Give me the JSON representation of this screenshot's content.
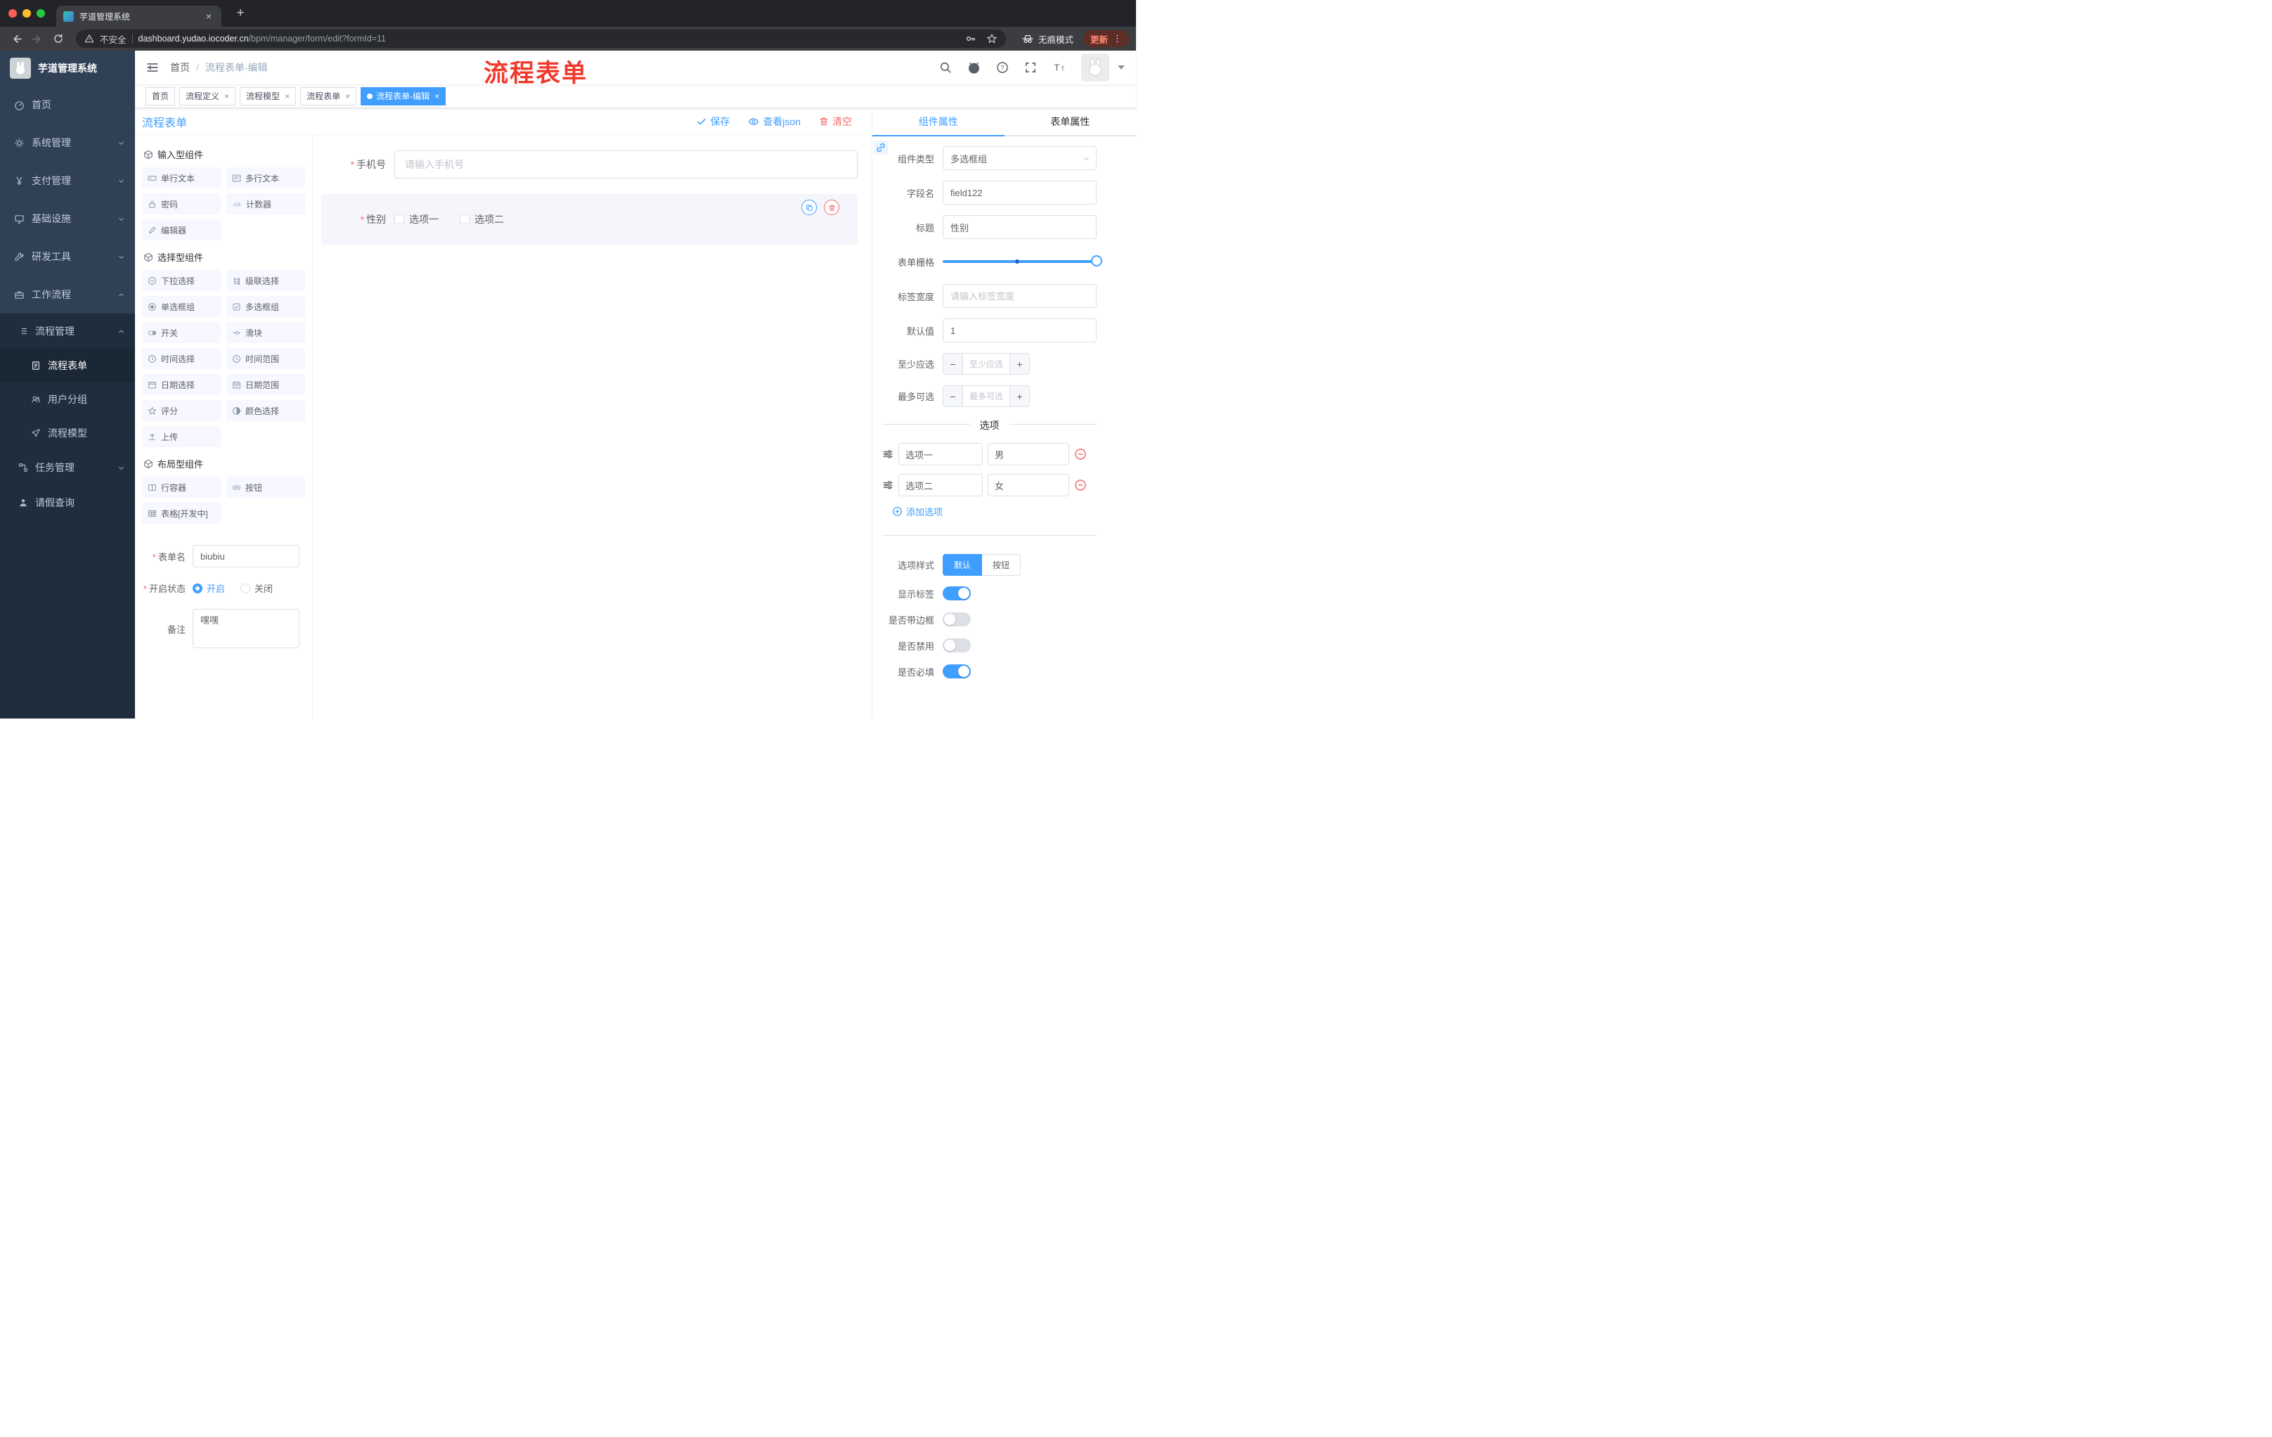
{
  "browser": {
    "tab_title": "芋道管理系统",
    "security_label": "不安全",
    "url_domain": "dashboard.yudao.iocoder.cn",
    "url_path": "/bpm/manager/form/edit?formId=11",
    "incognito_label": "无痕模式",
    "update_label": "更新"
  },
  "ui": {
    "close_glyph": "×",
    "plus_glyph": "+",
    "dots_glyph": "⋮"
  },
  "sidebar": {
    "logo_title": "芋道管理系统",
    "menu": [
      {
        "label": "首页"
      },
      {
        "label": "系统管理"
      },
      {
        "label": "支付管理"
      },
      {
        "label": "基础设施"
      },
      {
        "label": "研发工具"
      },
      {
        "label": "工作流程"
      }
    ],
    "workflow": {
      "group_label": "流程管理",
      "group_children": [
        {
          "label": "流程表单"
        },
        {
          "label": "用户分组"
        },
        {
          "label": "流程模型"
        }
      ],
      "task_label": "任务管理",
      "leave_label": "请假查询"
    }
  },
  "navbar": {
    "breadcrumb_home": "首页",
    "breadcrumb_current": "流程表单-编辑",
    "annotation": "流程表单"
  },
  "tags_view": [
    {
      "label": "首页"
    },
    {
      "label": "流程定义"
    },
    {
      "label": "流程模型"
    },
    {
      "label": "流程表单"
    },
    {
      "label": "流程表单-编辑"
    }
  ],
  "designer": {
    "title": "流程表单",
    "save_label": "保存",
    "view_json_label": "查看json",
    "clear_label": "清空"
  },
  "palette": {
    "sections": [
      {
        "title": "输入型组件",
        "items": [
          "单行文本",
          "多行文本",
          "密码",
          "计数器",
          "编辑器"
        ]
      },
      {
        "title": "选择型组件",
        "items": [
          "下拉选择",
          "级联选择",
          "单选框组",
          "多选框组",
          "开关",
          "滑块",
          "时间选择",
          "时间范围",
          "日期选择",
          "日期范围",
          "评分",
          "颜色选择",
          "上传"
        ]
      },
      {
        "title": "布局型组件",
        "items": [
          "行容器",
          "按钮",
          "表格[开发中]"
        ]
      }
    ]
  },
  "form_meta": {
    "name_label": "表单名",
    "name_value": "biubiu",
    "status_label": "开启状态",
    "status_on": "开启",
    "status_off": "关闭",
    "remark_label": "备注",
    "remark_value": "嘿嘿"
  },
  "canvas": {
    "phone_label": "手机号",
    "phone_placeholder": "请输入手机号",
    "gender_label": "性别",
    "gender_options": [
      "选项一",
      "选项二"
    ]
  },
  "props": {
    "tab_component": "组件属性",
    "tab_form": "表单属性",
    "rows": {
      "type_label": "组件类型",
      "type_value": "多选框组",
      "field_label": "字段名",
      "field_value": "field122",
      "title_label": "标题",
      "title_value": "性别",
      "grid_label": "表单栅格",
      "width_label": "标签宽度",
      "width_placeholder": "请输入标签宽度",
      "default_label": "默认值",
      "default_value": "1",
      "min_label": "至少应选",
      "min_placeholder": "至少应选",
      "max_label": "最多可选",
      "max_placeholder": "最多可选"
    },
    "options": {
      "title": "选项",
      "rows": [
        {
          "name": "选项一",
          "value": "男"
        },
        {
          "name": "选项二",
          "value": "女"
        }
      ],
      "add_label": "添加选项"
    },
    "style": {
      "label": "选项样式",
      "options": [
        "默认",
        "按钮"
      ]
    },
    "switches": {
      "show_label": "显示标签",
      "border_label": "是否带边框",
      "disabled_label": "是否禁用",
      "required_label": "是否必填"
    }
  },
  "colors": {
    "primary": "#409eff",
    "danger": "#f56c6c",
    "sidebar_bg": "#304156",
    "submenu_bg": "#1f2d3d",
    "annotation": "#f03a2c"
  }
}
